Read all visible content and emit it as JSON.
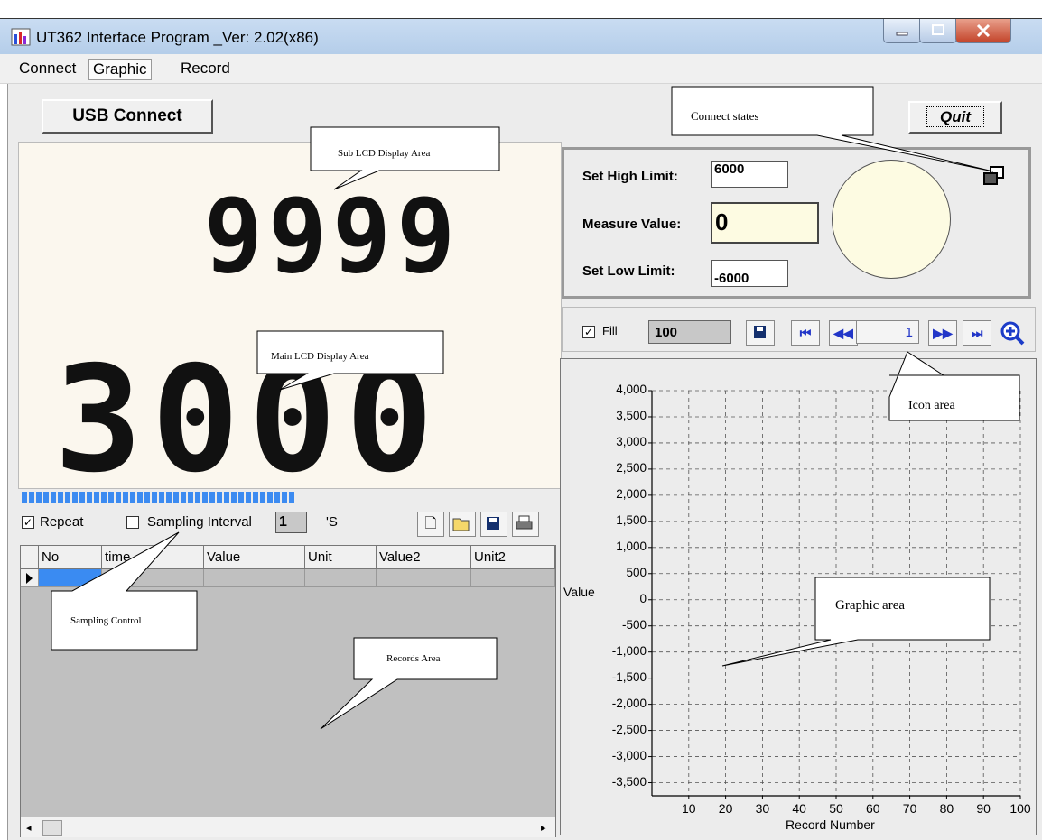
{
  "window": {
    "title": "UT362 Interface Program _Ver: 2.02(x86)"
  },
  "menu": {
    "items": [
      "Connect",
      "Graphic",
      "Record"
    ]
  },
  "controls": {
    "usb_connect": "USB Connect",
    "quit": "Quit"
  },
  "lcd": {
    "sub_value": "9999",
    "main_value": "3000"
  },
  "sampling": {
    "repeat_label": "Repeat",
    "repeat_checked": true,
    "interval_label": "Sampling Interval",
    "interval_checked": false,
    "interval_value": "1",
    "unit": "'S",
    "file_tools": [
      "new-file-icon",
      "open-folder-icon",
      "save-icon",
      "print-icon"
    ]
  },
  "records": {
    "columns": [
      "No",
      "time",
      "Value",
      "Unit",
      "Value2",
      "Unit2"
    ],
    "rows": []
  },
  "limits": {
    "high_label": "Set High Limit:",
    "high_value": "6000",
    "measure_label": "Measure Value:",
    "measure_value": "0",
    "low_label": "Set Low Limit:",
    "low_value": "-6000"
  },
  "graph_toolbar": {
    "fill_label": "Fill",
    "fill_checked": true,
    "count_value": "100",
    "page_value": "1",
    "icons": [
      "save-icon",
      "first-page-icon",
      "prev-page-icon",
      "next-page-icon",
      "last-page-icon",
      "zoom-in-icon"
    ]
  },
  "chart_data": {
    "type": "line",
    "ylabel": "Value",
    "xlabel": "Record Number",
    "ylim": [
      -3500,
      4000
    ],
    "y_ticks": [
      "4,000",
      "3,500",
      "3,000",
      "2,500",
      "2,000",
      "1,500",
      "1,000",
      "500",
      "0",
      "-500",
      "-1,000",
      "-1,500",
      "-2,000",
      "-2,500",
      "-3,000",
      "-3,500"
    ],
    "x_ticks": [
      "10",
      "20",
      "30",
      "40",
      "50",
      "60",
      "70",
      "80",
      "90",
      "100"
    ],
    "xlim": [
      0,
      100
    ],
    "grid": true,
    "series": []
  },
  "annotations": {
    "connect_states": "Connect states",
    "sub_lcd": "Sub LCD Display Area",
    "main_lcd": "Main LCD Display Area",
    "icon_area": "Icon area",
    "sampling_control": "Sampling Control",
    "records_area": "Records Area",
    "graphic_area": "Graphic area"
  },
  "colors": {
    "titlebar": "#b9d1ea",
    "lcd_bg": "#fbf7ee",
    "progress": "#3c8bf1",
    "gauge": "#fdfbe2",
    "nav_icon": "#2236c8"
  }
}
